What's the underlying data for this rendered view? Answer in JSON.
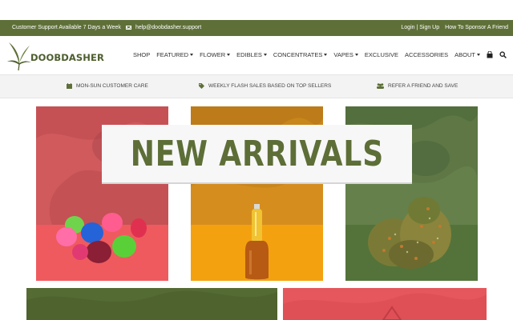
{
  "topbar": {
    "support_text": "Customer Support Available 7 Days a Week",
    "email": "help@doobdasher.support",
    "login_label": "Login | Sign Up",
    "sponsor_label": "How To Sponsor A Friend"
  },
  "logo": {
    "text": "DOOBDASHER"
  },
  "nav": {
    "items": [
      {
        "label": "SHOP",
        "caret": false
      },
      {
        "label": "FEATURED",
        "caret": true
      },
      {
        "label": "FLOWER",
        "caret": true
      },
      {
        "label": "EDIBLES",
        "caret": true
      },
      {
        "label": "CONCENTRATES",
        "caret": true
      },
      {
        "label": "VAPES",
        "caret": true
      },
      {
        "label": "EXCLUSIVE",
        "caret": false
      },
      {
        "label": "ACCESSORIES",
        "caret": false
      },
      {
        "label": "ABOUT",
        "caret": true
      }
    ],
    "icons": [
      "bag-icon",
      "search-icon"
    ]
  },
  "benefits": [
    {
      "label": "MON-SUN CUSTOMER CARE",
      "icon": "calendar-icon"
    },
    {
      "label": "WEEKLY FLASH SALES BASED ON TOP SELLERS",
      "icon": "tag-icon"
    },
    {
      "label": "REFER A FRIEND AND SAVE",
      "icon": "users-icon"
    }
  ],
  "hero": {
    "title": "NEW ARRIVALS",
    "panels": [
      {
        "name": "edibles-panel",
        "color": "#d05a5c",
        "icon": "gummy-bears-image"
      },
      {
        "name": "concentrates-panel",
        "color": "#c9861b",
        "icon": "oil-bottle-image"
      },
      {
        "name": "flower-panel",
        "color": "#5e7745",
        "icon": "cannabis-bud-image"
      }
    ]
  },
  "colors": {
    "brand": "#5e7038",
    "title": "#5d6e37",
    "red": "#ef5a5f",
    "orange": "#f4a10f",
    "green": "#53733a"
  }
}
